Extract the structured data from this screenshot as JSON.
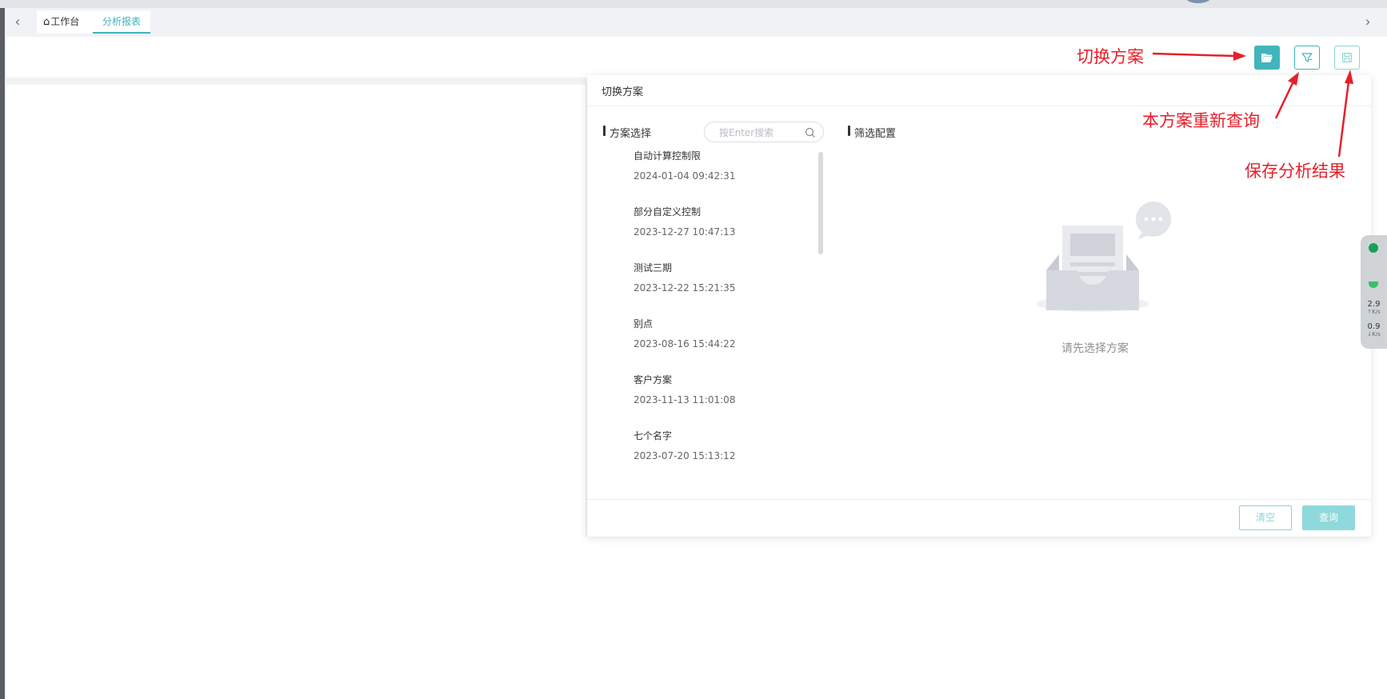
{
  "tabs": {
    "home_label": "工作台",
    "report_label": "分析报表"
  },
  "toolbar": {
    "switch_icon": "folder-open-icon",
    "requery_icon": "filter-icon",
    "save_icon": "save-icon"
  },
  "dialog": {
    "title": "切换方案",
    "plans_section_title": "方案选择",
    "filter_section_title": "筛选配置",
    "search_placeholder": "按Enter搜索",
    "search_value": "",
    "empty_text": "请先选择方案",
    "clear_label": "清空",
    "query_label": "查询",
    "plans": [
      {
        "name": "自动计算控制限",
        "date": "2024-01-04 09:42:31"
      },
      {
        "name": "部分自定义控制",
        "date": "2023-12-27 10:47:13"
      },
      {
        "name": "测试三期",
        "date": "2023-12-22 15:21:35"
      },
      {
        "name": "别点",
        "date": "2023-08-16 15:44:22"
      },
      {
        "name": "客户方案",
        "date": "2023-11-13 11:01:08"
      },
      {
        "name": "七个名字",
        "date": "2023-07-20 15:13:12"
      }
    ]
  },
  "annotations": {
    "switch_plan": "切换方案",
    "requery": "本方案重新查询",
    "save_result": "保存分析结果",
    "color": "#e5202b"
  },
  "net_widget": {
    "upload_value": "2.9",
    "download_value": "0.9",
    "unit": "K/s"
  },
  "colors": {
    "accent": "#40b5bc",
    "accent_light": "#8fd8dc",
    "annotation_red": "#e5202b"
  }
}
